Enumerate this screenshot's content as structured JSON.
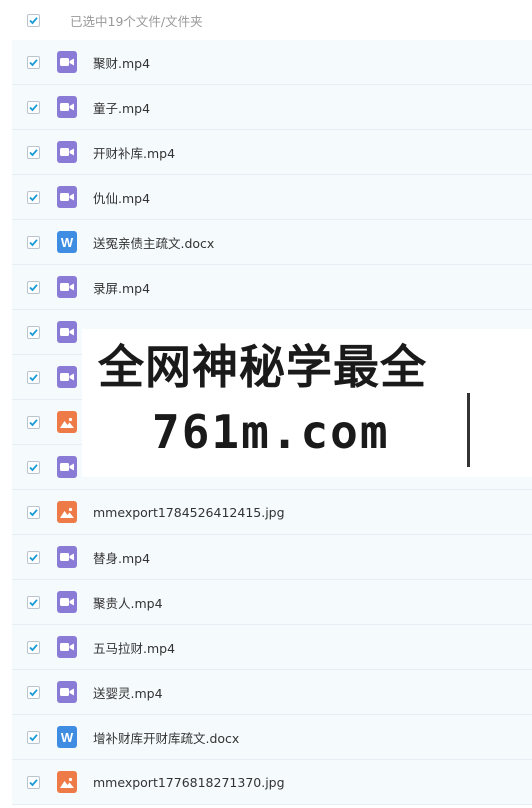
{
  "header": {
    "selection_text": "已选中19个文件/文件夹"
  },
  "files": [
    {
      "name": "聚财.mp4",
      "type": "video"
    },
    {
      "name": "童子.mp4",
      "type": "video"
    },
    {
      "name": "开财补库.mp4",
      "type": "video"
    },
    {
      "name": "仇仙.mp4",
      "type": "video"
    },
    {
      "name": "送冤亲债主疏文.docx",
      "type": "word"
    },
    {
      "name": "录屏.mp4",
      "type": "video"
    },
    {
      "name": "",
      "type": "video"
    },
    {
      "name": "",
      "type": "video"
    },
    {
      "name": "",
      "type": "image"
    },
    {
      "name": "",
      "type": "video"
    },
    {
      "name": "mmexport1784526412415.jpg",
      "type": "image"
    },
    {
      "name": "替身.mp4",
      "type": "video"
    },
    {
      "name": "聚贵人.mp4",
      "type": "video"
    },
    {
      "name": "五马拉财.mp4",
      "type": "video"
    },
    {
      "name": "送婴灵.mp4",
      "type": "video"
    },
    {
      "name": "增补财库开财库疏文.docx",
      "type": "word"
    },
    {
      "name": "mmexport1776818271370.jpg",
      "type": "image"
    }
  ],
  "watermark": {
    "line1": "全网神秘学最全",
    "line2": "761m.com"
  },
  "colors": {
    "checkbox_check": "#1a9bd8",
    "video_icon": "#8a7bd6",
    "word_icon": "#3f8de3",
    "image_icon": "#ee7b47"
  }
}
